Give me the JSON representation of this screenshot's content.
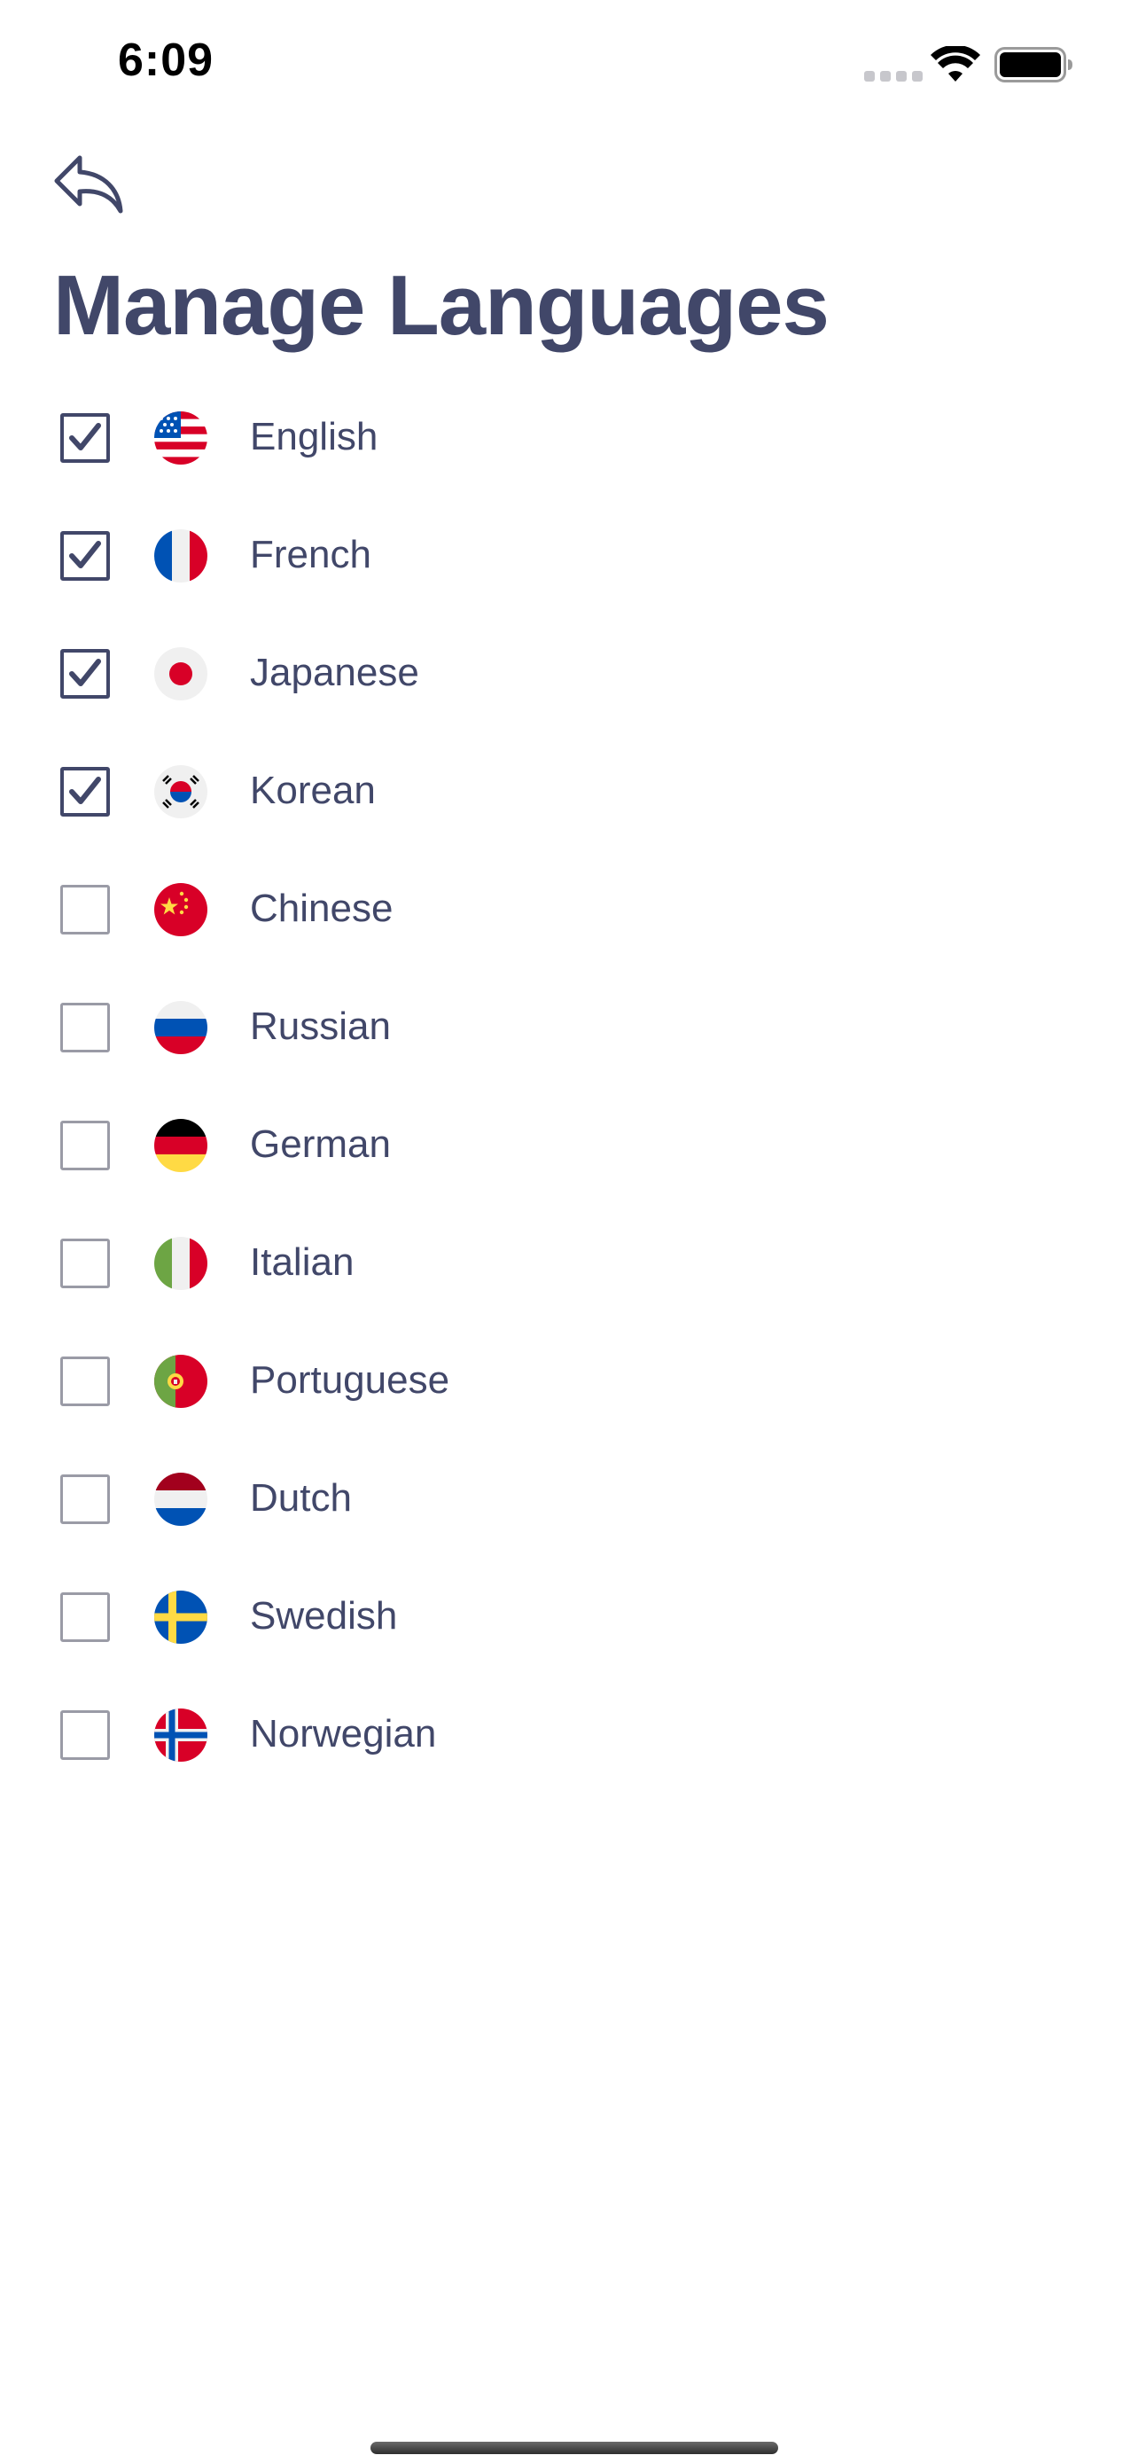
{
  "status_bar": {
    "time": "6:09",
    "icons": [
      "signal-dots-icon",
      "wifi-icon",
      "battery-icon"
    ]
  },
  "header": {
    "back_icon": "back-arrow-icon",
    "title": "Manage Languages"
  },
  "colors": {
    "primary_text": "#414769",
    "checkbox_unchecked_border": "#9a9ba6",
    "background": "#ffffff"
  },
  "languages": [
    {
      "label": "English",
      "checked": true,
      "flag": "us-flag-icon"
    },
    {
      "label": "French",
      "checked": true,
      "flag": "france-flag-icon"
    },
    {
      "label": "Japanese",
      "checked": true,
      "flag": "japan-flag-icon"
    },
    {
      "label": "Korean",
      "checked": true,
      "flag": "korea-flag-icon"
    },
    {
      "label": "Chinese",
      "checked": false,
      "flag": "china-flag-icon"
    },
    {
      "label": "Russian",
      "checked": false,
      "flag": "russia-flag-icon"
    },
    {
      "label": "German",
      "checked": false,
      "flag": "germany-flag-icon"
    },
    {
      "label": "Italian",
      "checked": false,
      "flag": "italy-flag-icon"
    },
    {
      "label": "Portuguese",
      "checked": false,
      "flag": "portugal-flag-icon"
    },
    {
      "label": "Dutch",
      "checked": false,
      "flag": "netherlands-flag-icon"
    },
    {
      "label": "Swedish",
      "checked": false,
      "flag": "sweden-flag-icon"
    },
    {
      "label": "Norwegian",
      "checked": false,
      "flag": "norway-flag-icon"
    }
  ]
}
